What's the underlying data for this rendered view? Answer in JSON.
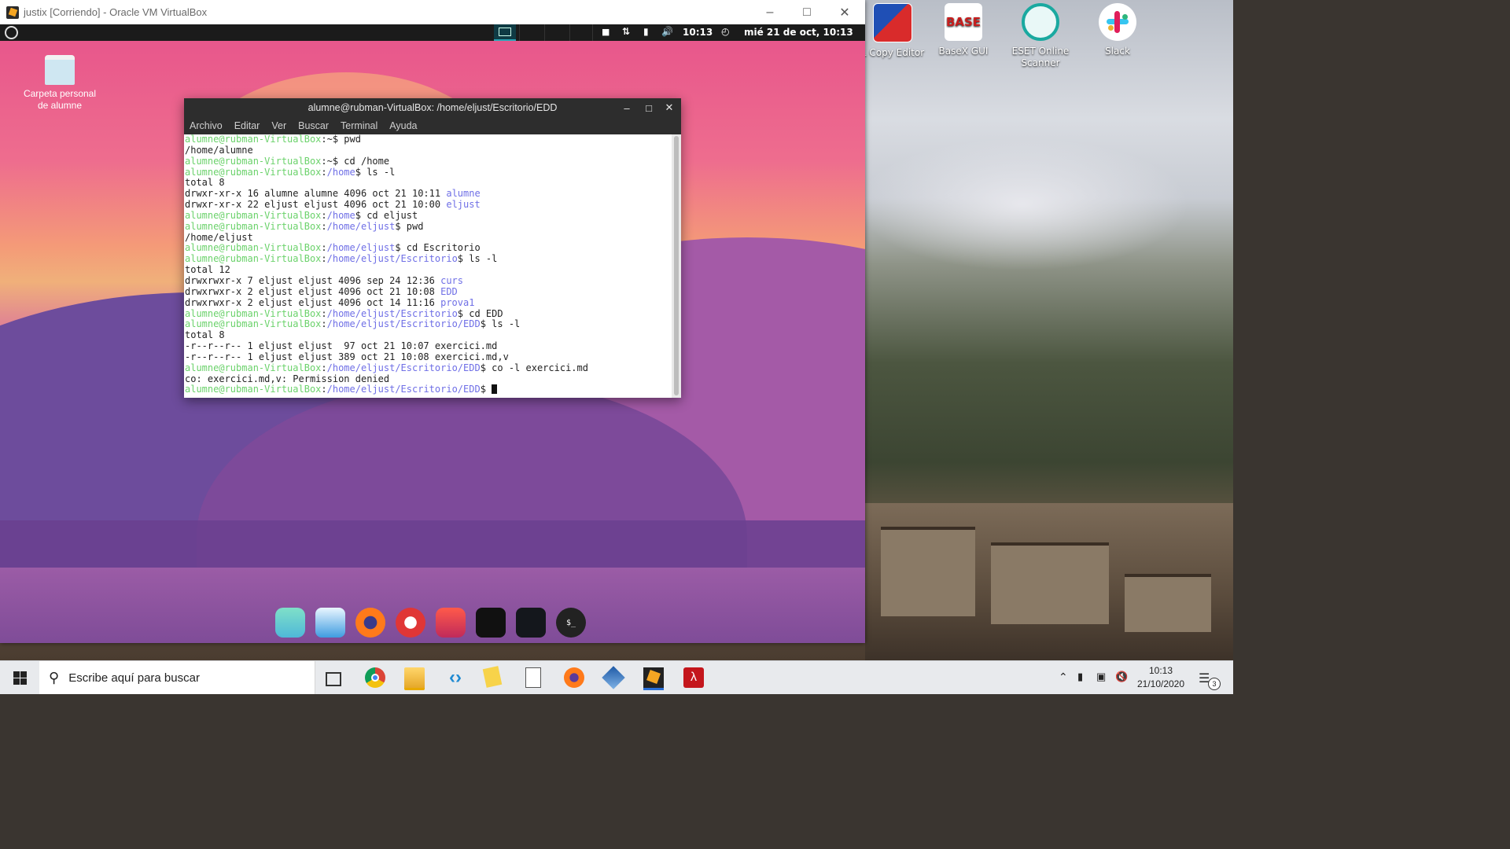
{
  "host": {
    "desktop_icons": [
      {
        "label": "L Copy Editor",
        "icon": "copy-editor-icon"
      },
      {
        "label": "BaseX GUI",
        "icon": "basex-icon",
        "badge": "BASE"
      },
      {
        "label": "ESET Online Scanner",
        "icon": "eset-icon"
      },
      {
        "label": "Slack",
        "icon": "slack-icon"
      }
    ],
    "taskbar": {
      "search_placeholder": "Escribe aquí para buscar",
      "time": "10:13",
      "date": "21/10/2020",
      "notif_count": "3"
    }
  },
  "vbox": {
    "title": "justix [Corriendo] - Oracle VM VirtualBox"
  },
  "guest": {
    "panel": {
      "time": "10:13",
      "date": "mié 21 de oct, 10:13"
    },
    "desktop_icon_label_1": "Carpeta personal",
    "desktop_icon_label_2": "de alumne"
  },
  "terminal": {
    "title": "alumne@rubman-VirtualBox: /home/eljust/Escritorio/EDD",
    "menu": [
      "Archivo",
      "Editar",
      "Ver",
      "Buscar",
      "Terminal",
      "Ayuda"
    ],
    "lines": [
      [
        {
          "t": "alumne@rubman-VirtualBox",
          "c": "g"
        },
        {
          "t": ":~$ pwd",
          "c": ""
        }
      ],
      [
        {
          "t": "/home/alumne",
          "c": ""
        }
      ],
      [
        {
          "t": "alumne@rubman-VirtualBox",
          "c": "g"
        },
        {
          "t": ":~$ cd /home",
          "c": ""
        }
      ],
      [
        {
          "t": "alumne@rubman-VirtualBox",
          "c": "g"
        },
        {
          "t": ":",
          "c": ""
        },
        {
          "t": "/home",
          "c": "b"
        },
        {
          "t": "$ ls -l",
          "c": ""
        }
      ],
      [
        {
          "t": "total 8",
          "c": ""
        }
      ],
      [
        {
          "t": "drwxr-xr-x 16 alumne alumne 4096 oct 21 10:11 ",
          "c": ""
        },
        {
          "t": "alumne",
          "c": "b"
        }
      ],
      [
        {
          "t": "drwxr-xr-x 22 eljust eljust 4096 oct 21 10:00 ",
          "c": ""
        },
        {
          "t": "eljust",
          "c": "b"
        }
      ],
      [
        {
          "t": "alumne@rubman-VirtualBox",
          "c": "g"
        },
        {
          "t": ":",
          "c": ""
        },
        {
          "t": "/home",
          "c": "b"
        },
        {
          "t": "$ cd eljust",
          "c": ""
        }
      ],
      [
        {
          "t": "alumne@rubman-VirtualBox",
          "c": "g"
        },
        {
          "t": ":",
          "c": ""
        },
        {
          "t": "/home/eljust",
          "c": "b"
        },
        {
          "t": "$ pwd",
          "c": ""
        }
      ],
      [
        {
          "t": "/home/eljust",
          "c": ""
        }
      ],
      [
        {
          "t": "alumne@rubman-VirtualBox",
          "c": "g"
        },
        {
          "t": ":",
          "c": ""
        },
        {
          "t": "/home/eljust",
          "c": "b"
        },
        {
          "t": "$ cd Escritorio",
          "c": ""
        }
      ],
      [
        {
          "t": "alumne@rubman-VirtualBox",
          "c": "g"
        },
        {
          "t": ":",
          "c": ""
        },
        {
          "t": "/home/eljust/Escritorio",
          "c": "b"
        },
        {
          "t": "$ ls -l",
          "c": ""
        }
      ],
      [
        {
          "t": "total 12",
          "c": ""
        }
      ],
      [
        {
          "t": "drwxrwxr-x 7 eljust eljust 4096 sep 24 12:36 ",
          "c": ""
        },
        {
          "t": "curs",
          "c": "b"
        }
      ],
      [
        {
          "t": "drwxrwxr-x 2 eljust eljust 4096 oct 21 10:08 ",
          "c": ""
        },
        {
          "t": "EDD",
          "c": "b"
        }
      ],
      [
        {
          "t": "drwxrwxr-x 2 eljust eljust 4096 oct 14 11:16 ",
          "c": ""
        },
        {
          "t": "prova1",
          "c": "b"
        }
      ],
      [
        {
          "t": "alumne@rubman-VirtualBox",
          "c": "g"
        },
        {
          "t": ":",
          "c": ""
        },
        {
          "t": "/home/eljust/Escritorio",
          "c": "b"
        },
        {
          "t": "$ cd EDD",
          "c": ""
        }
      ],
      [
        {
          "t": "alumne@rubman-VirtualBox",
          "c": "g"
        },
        {
          "t": ":",
          "c": ""
        },
        {
          "t": "/home/eljust/Escritorio/EDD",
          "c": "b"
        },
        {
          "t": "$ ls -l",
          "c": ""
        }
      ],
      [
        {
          "t": "total 8",
          "c": ""
        }
      ],
      [
        {
          "t": "-r--r--r-- 1 eljust eljust  97 oct 21 10:07 exercici.md",
          "c": ""
        }
      ],
      [
        {
          "t": "-r--r--r-- 1 eljust eljust 389 oct 21 10:08 exercici.md,v",
          "c": ""
        }
      ],
      [
        {
          "t": "alumne@rubman-VirtualBox",
          "c": "g"
        },
        {
          "t": ":",
          "c": ""
        },
        {
          "t": "/home/eljust/Escritorio/EDD",
          "c": "b"
        },
        {
          "t": "$ co -l exercici.md",
          "c": ""
        }
      ],
      [
        {
          "t": "co: exercici.md,v: Permission denied",
          "c": ""
        }
      ],
      [
        {
          "t": "alumne@rubman-VirtualBox",
          "c": "g"
        },
        {
          "t": ":",
          "c": ""
        },
        {
          "t": "/home/eljust/Escritorio/EDD",
          "c": "b"
        },
        {
          "t": "$ ",
          "c": ""
        }
      ]
    ]
  },
  "colors": {
    "prompt_green": "#6bd26b",
    "path_blue": "#6f6fe6"
  }
}
